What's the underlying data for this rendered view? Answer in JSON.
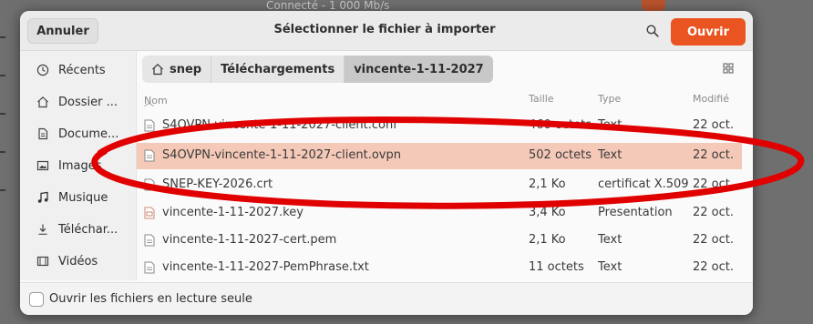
{
  "background": {
    "status_text": "Connecté - 1 000 Mb/s"
  },
  "header": {
    "cancel_label": "Annuler",
    "title": "Sélectionner le fichier à importer",
    "search_icon": "search-icon",
    "open_label": "Ouvrir"
  },
  "sidebar": {
    "items": [
      {
        "label": "Récents",
        "icon": "clock-icon"
      },
      {
        "label": "Dossier ...",
        "icon": "home-icon"
      },
      {
        "label": "Docume...",
        "icon": "document-icon"
      },
      {
        "label": "Images",
        "icon": "image-icon"
      },
      {
        "label": "Musique",
        "icon": "music-icon"
      },
      {
        "label": "Téléchar...",
        "icon": "download-icon"
      },
      {
        "label": "Vidéos",
        "icon": "film-icon"
      }
    ]
  },
  "breadcrumb": [
    "snep",
    "Téléchargements",
    "vincente-1-11-2027"
  ],
  "columns": {
    "name": "Nom",
    "size": "Taille",
    "type": "Type",
    "modified": "Modifié"
  },
  "files": [
    {
      "name": "S4OVPN-vincente-1-11-2027-client.conf",
      "size": "460 octets",
      "type": "Text",
      "modified": "22 oct."
    },
    {
      "name": "S4OVPN-vincente-1-11-2027-client.ovpn",
      "size": "502 octets",
      "type": "Text",
      "modified": "22 oct.",
      "selected": true
    },
    {
      "name": "SNEP-KEY-2026.crt",
      "size": "2,1 Ko",
      "type": "certificat X.509",
      "modified": "22 oct."
    },
    {
      "name": "vincente-1-11-2027.key",
      "size": "3,4 Ko",
      "type": "Presentation",
      "modified": "22 oct."
    },
    {
      "name": "vincente-1-11-2027-cert.pem",
      "size": "2,1 Ko",
      "type": "Text",
      "modified": "22 oct."
    },
    {
      "name": "vincente-1-11-2027-PemPhrase.txt",
      "size": "11 octets",
      "type": "Text",
      "modified": "22 oct."
    }
  ],
  "footer": {
    "readonly_label": "Ouvrir les fichiers en lecture seule",
    "readonly_checked": false
  },
  "colors": {
    "accent": "#e95420",
    "selection": "#f5c9b8",
    "annotation": "#e00000"
  }
}
